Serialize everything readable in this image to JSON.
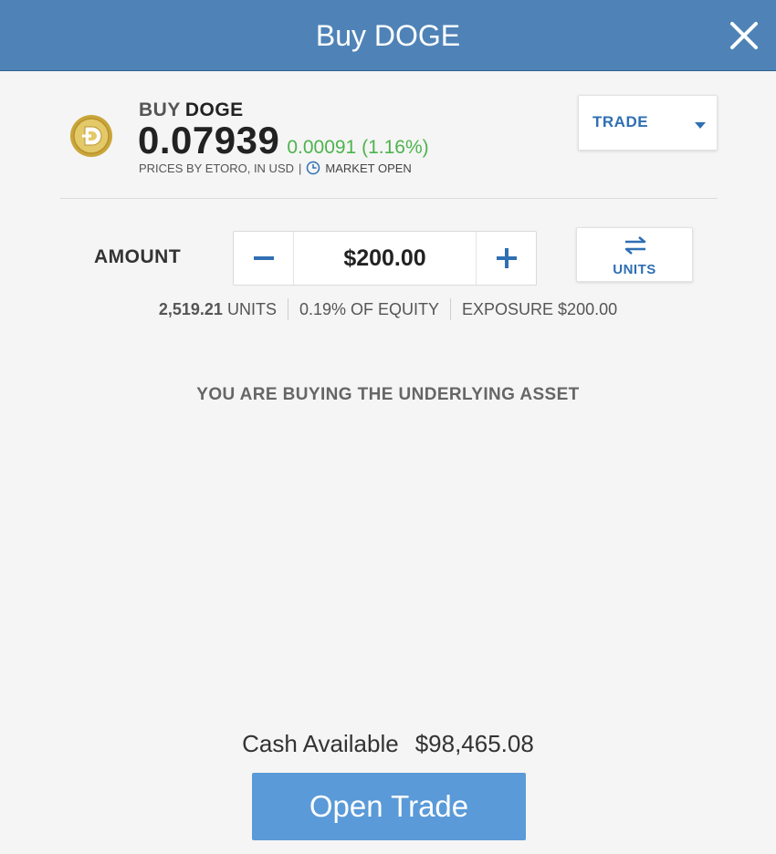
{
  "header": {
    "title": "Buy DOGE"
  },
  "instrument": {
    "buy_word": "BUY",
    "symbol": "DOGE",
    "price": "0.07939",
    "change": "0.00091 (1.16%)",
    "prices_by": "PRICES BY ETORO, IN USD",
    "separator": "|",
    "market_status": "MARKET OPEN"
  },
  "mode_select": {
    "selected": "TRADE"
  },
  "amount": {
    "label": "AMOUNT",
    "value": "$200.00",
    "toggle_label": "UNITS"
  },
  "stats": {
    "units_value": "2,519.21",
    "units_suffix": "UNITS",
    "equity": "0.19% OF EQUITY",
    "exposure": "EXPOSURE $200.00"
  },
  "notice": "YOU ARE BUYING THE UNDERLYING ASSET",
  "footer": {
    "cash_label": "Cash Available",
    "cash_value": "$98,465.08",
    "open_button": "Open Trade"
  },
  "colors": {
    "header_bg": "#4f83b7",
    "accent_blue": "#2f6fb3",
    "positive_green": "#4db34d",
    "button_bg": "#5a9ad8"
  },
  "icons": [
    "close-icon",
    "doge-coin-icon",
    "clock-icon",
    "caret-down-icon",
    "minus-icon",
    "plus-icon",
    "swap-arrows-icon"
  ]
}
